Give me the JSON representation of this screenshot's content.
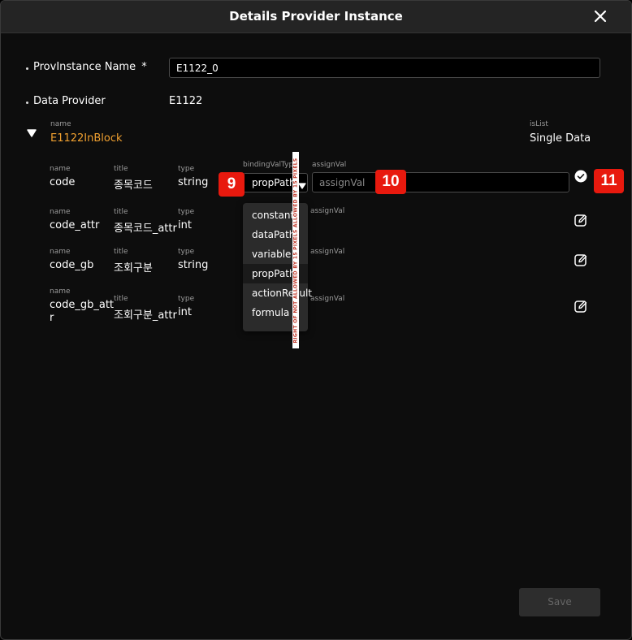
{
  "dialog": {
    "title": "Details Provider Instance",
    "close_icon": "close-icon"
  },
  "form": {
    "provinstance_label": "ProvInstance Name",
    "provinstance_required_mark": "*",
    "provinstance_value": "E1122_0",
    "data_provider_label": "Data Provider",
    "data_provider_value": "E1122"
  },
  "block": {
    "name_caption": "name",
    "name": "E1122InBlock",
    "islist_caption": "isList",
    "islist_value": "Single Data"
  },
  "field_captions": {
    "name": "name",
    "title": "title",
    "type": "type",
    "binding": "bindingValTyp",
    "assign": "assignVal"
  },
  "rows": [
    {
      "name": "code",
      "title": "종목코드",
      "type": "string",
      "binding": "propPath",
      "assign_placeholder": "assignVal"
    },
    {
      "name": "code_attr",
      "title": "종목코드_attr",
      "type": "int"
    },
    {
      "name": "code_gb",
      "title": "조회구분",
      "type": "string"
    },
    {
      "name": "code_gb_attr",
      "title": "조회구분_attr",
      "type": "int"
    }
  ],
  "dropdown_options": [
    "constant",
    "dataPath",
    "variable",
    "propPath",
    "actionResult",
    "formula"
  ],
  "dropdown_selected": "propPath",
  "overlay_ribbon": "RIGHT OF NOT ALLOWED BY 15 PIXELS ALLOWED BY 15 PIXELS",
  "badges": [
    "9",
    "10",
    "11"
  ],
  "save_label": "Save",
  "colors": {
    "accent_orange": "#f0a030",
    "badge_red": "#e8190e",
    "background": "#0d0d0d"
  }
}
